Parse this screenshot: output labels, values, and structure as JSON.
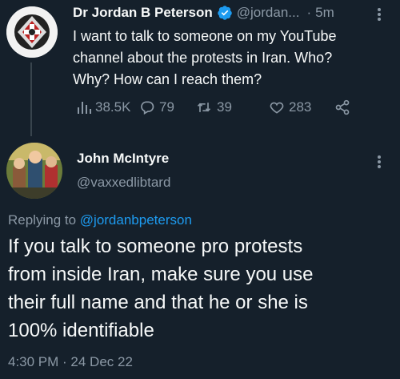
{
  "parent_tweet": {
    "display_name": "Dr Jordan B Peterson",
    "handle": "@jordan...",
    "separator": "·",
    "time_ago": "5m",
    "text_lines": [
      "I want to talk to someone on my YouTube",
      "channel about the protests in Iran. Who?",
      "Why? How can I reach them?"
    ],
    "views": "38.5K",
    "replies": "79",
    "retweets": "39",
    "likes": "283"
  },
  "reply_tweet": {
    "display_name": "John McIntyre",
    "handle": "@vaxxedlibtard",
    "replying_prefix": "Replying to ",
    "replying_handle": "@jordanbpeterson",
    "text_lines": [
      "If you talk to someone pro protests",
      "from inside Iran, make sure you use",
      "their full name and that he or she is",
      "100% identifiable"
    ],
    "timestamp": "4:30 PM · 24 Dec 22"
  },
  "colors": {
    "background": "#15202b",
    "text": "#f7f9f9",
    "muted": "#8b98a5",
    "accent": "#1d9bf0",
    "thread_line": "#38444d"
  },
  "icons": [
    "verified-badge-icon",
    "more-icon",
    "views-icon",
    "reply-icon",
    "retweet-icon",
    "like-icon",
    "share-icon"
  ]
}
